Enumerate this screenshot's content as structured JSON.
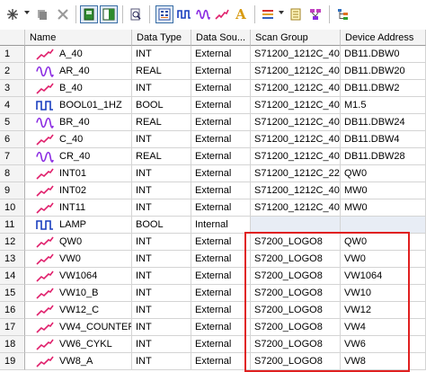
{
  "toolbar": {
    "buttons": [
      {
        "icon": "asterisk-new-icon"
      },
      {
        "icon": "stack-icon"
      },
      {
        "icon": "delete-x-icon"
      },
      {
        "icon": "green-monitor-icon"
      },
      {
        "icon": "split-view-icon"
      },
      {
        "icon": "magnify-page-icon"
      },
      {
        "icon": "grid-view-icon"
      },
      {
        "icon": "square-wave-icon"
      },
      {
        "icon": "sine-wave-icon"
      },
      {
        "icon": "ramp-icon"
      },
      {
        "icon": "text-a-icon"
      },
      {
        "icon": "bar-chart-icon"
      },
      {
        "icon": "properties-icon"
      },
      {
        "icon": "network-icon"
      },
      {
        "icon": "tree-icon"
      }
    ]
  },
  "columns": [
    "Name",
    "Data Type",
    "Data Sou...",
    "Scan Group",
    "Device Address"
  ],
  "rows": [
    {
      "num": "1",
      "icon": "ramp",
      "name": "A_40",
      "type": "INT",
      "source": "External",
      "group": "S71200_1212C_40",
      "address": "DB11.DBW0"
    },
    {
      "num": "2",
      "icon": "sine",
      "name": "AR_40",
      "type": "REAL",
      "source": "External",
      "group": "S71200_1212C_40",
      "address": "DB11.DBW20"
    },
    {
      "num": "3",
      "icon": "ramp",
      "name": "B_40",
      "type": "INT",
      "source": "External",
      "group": "S71200_1212C_40",
      "address": "DB11.DBW2"
    },
    {
      "num": "4",
      "icon": "square",
      "name": "BOOL01_1HZ",
      "type": "BOOL",
      "source": "External",
      "group": "S71200_1212C_40",
      "address": "M1.5"
    },
    {
      "num": "5",
      "icon": "sine",
      "name": "BR_40",
      "type": "REAL",
      "source": "External",
      "group": "S71200_1212C_40",
      "address": "DB11.DBW24"
    },
    {
      "num": "6",
      "icon": "ramp",
      "name": "C_40",
      "type": "INT",
      "source": "External",
      "group": "S71200_1212C_40",
      "address": "DB11.DBW4"
    },
    {
      "num": "7",
      "icon": "sine",
      "name": "CR_40",
      "type": "REAL",
      "source": "External",
      "group": "S71200_1212C_40",
      "address": "DB11.DBW28"
    },
    {
      "num": "8",
      "icon": "ramp",
      "name": "INT01",
      "type": "INT",
      "source": "External",
      "group": "S71200_1212C_22",
      "address": "QW0"
    },
    {
      "num": "9",
      "icon": "ramp",
      "name": "INT02",
      "type": "INT",
      "source": "External",
      "group": "S71200_1212C_40",
      "address": "MW0"
    },
    {
      "num": "10",
      "icon": "ramp",
      "name": "INT11",
      "type": "INT",
      "source": "External",
      "group": "S71200_1212C_40",
      "address": "MW0"
    },
    {
      "num": "11",
      "icon": "square",
      "name": "LAMP",
      "type": "BOOL",
      "source": "Internal",
      "group": "",
      "address": ""
    },
    {
      "num": "12",
      "icon": "ramp",
      "name": "QW0",
      "type": "INT",
      "source": "External",
      "group": "S7200_LOGO8",
      "address": "QW0"
    },
    {
      "num": "13",
      "icon": "ramp",
      "name": "VW0",
      "type": "INT",
      "source": "External",
      "group": "S7200_LOGO8",
      "address": "VW0"
    },
    {
      "num": "14",
      "icon": "ramp",
      "name": "VW1064",
      "type": "INT",
      "source": "External",
      "group": "S7200_LOGO8",
      "address": "VW1064"
    },
    {
      "num": "15",
      "icon": "ramp",
      "name": "VW10_B",
      "type": "INT",
      "source": "External",
      "group": "S7200_LOGO8",
      "address": "VW10"
    },
    {
      "num": "16",
      "icon": "ramp",
      "name": "VW12_C",
      "type": "INT",
      "source": "External",
      "group": "S7200_LOGO8",
      "address": "VW12"
    },
    {
      "num": "17",
      "icon": "ramp",
      "name": "VW4_COUNTER",
      "type": "INT",
      "source": "External",
      "group": "S7200_LOGO8",
      "address": "VW4"
    },
    {
      "num": "18",
      "icon": "ramp",
      "name": "VW6_CYKL",
      "type": "INT",
      "source": "External",
      "group": "S7200_LOGO8",
      "address": "VW6"
    },
    {
      "num": "19",
      "icon": "ramp",
      "name": "VW8_A",
      "type": "INT",
      "source": "External",
      "group": "S7200_LOGO8",
      "address": "VW8"
    }
  ],
  "colors": {
    "ramp": "#e0206c",
    "sine": "#8a2be2",
    "square": "#1a3fbf",
    "highlight": "#e02020"
  }
}
